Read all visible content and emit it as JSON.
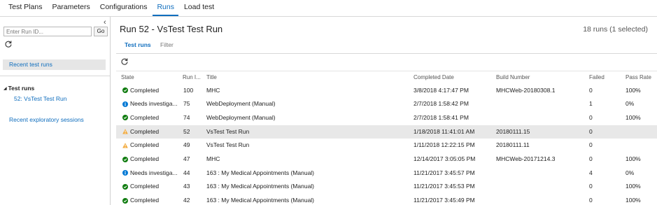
{
  "topnav": {
    "tabs": [
      {
        "label": "Test Plans",
        "active": false
      },
      {
        "label": "Parameters",
        "active": false
      },
      {
        "label": "Configurations",
        "active": false
      },
      {
        "label": "Runs",
        "active": true
      },
      {
        "label": "Load test",
        "active": false
      }
    ]
  },
  "sidebar": {
    "collapse_glyph": "‹",
    "runid_placeholder": "Enter Run ID...",
    "go_label": "Go",
    "recent_runs_label": "Recent test runs",
    "group_label": "Test runs",
    "group_glyph": "◢",
    "run_item_label": "52: VsTest Test Run",
    "exploratory_label": "Recent exploratory sessions"
  },
  "main": {
    "title": "Run 52 - VsTest Test Run",
    "runs_count": "18 runs (1 selected)",
    "subtabs": {
      "test_runs": "Test runs",
      "filter": "Filter"
    }
  },
  "grid": {
    "headers": {
      "state": "State",
      "run_id": "Run I...",
      "title": "Title",
      "completed": "Completed Date",
      "build": "Build Number",
      "failed": "Failed",
      "pass_rate": "Pass Rate"
    },
    "rows": [
      {
        "icon": "check-circle-icon",
        "state": "Completed",
        "run_id": "100",
        "title": "MHC",
        "completed": "3/8/2018 4:17:47 PM",
        "build": "MHCWeb-20180308.1",
        "failed": "0",
        "pass_rate": "100%"
      },
      {
        "icon": "info-circle-icon",
        "state": "Needs investiga...",
        "run_id": "75",
        "title": "WebDeployment (Manual)",
        "completed": "2/7/2018 1:58:42 PM",
        "build": "",
        "failed": "1",
        "pass_rate": "0%"
      },
      {
        "icon": "check-circle-icon",
        "state": "Completed",
        "run_id": "74",
        "title": "WebDeployment (Manual)",
        "completed": "2/7/2018 1:58:41 PM",
        "build": "",
        "failed": "0",
        "pass_rate": "100%"
      },
      {
        "icon": "warning-icon",
        "state": "Completed",
        "run_id": "52",
        "title": "VsTest Test Run",
        "completed": "1/18/2018 11:41:01 AM",
        "build": "20180111.15",
        "failed": "0",
        "pass_rate": "",
        "selected": true
      },
      {
        "icon": "warning-icon",
        "state": "Completed",
        "run_id": "49",
        "title": "VsTest Test Run",
        "completed": "1/11/2018 12:22:15 PM",
        "build": "20180111.11",
        "failed": "0",
        "pass_rate": ""
      },
      {
        "icon": "check-circle-icon",
        "state": "Completed",
        "run_id": "47",
        "title": "MHC",
        "completed": "12/14/2017 3:05:05 PM",
        "build": "MHCWeb-20171214.3",
        "failed": "0",
        "pass_rate": "100%"
      },
      {
        "icon": "info-circle-icon",
        "state": "Needs investiga...",
        "run_id": "44",
        "title": "163 : My Medical Appointments (Manual)",
        "completed": "11/21/2017 3:45:57 PM",
        "build": "",
        "failed": "4",
        "pass_rate": "0%"
      },
      {
        "icon": "check-circle-icon",
        "state": "Completed",
        "run_id": "43",
        "title": "163 : My Medical Appointments (Manual)",
        "completed": "11/21/2017 3:45:53 PM",
        "build": "",
        "failed": "0",
        "pass_rate": "100%"
      },
      {
        "icon": "check-circle-icon",
        "state": "Completed",
        "run_id": "42",
        "title": "163 : My Medical Appointments (Manual)",
        "completed": "11/21/2017 3:45:49 PM",
        "build": "",
        "failed": "0",
        "pass_rate": "100%"
      }
    ]
  },
  "colors": {
    "accent": "#106ebe",
    "success": "#107c10",
    "info": "#0078d4",
    "warning": "#f2a93b",
    "selected_row": "#e8e8e8"
  }
}
